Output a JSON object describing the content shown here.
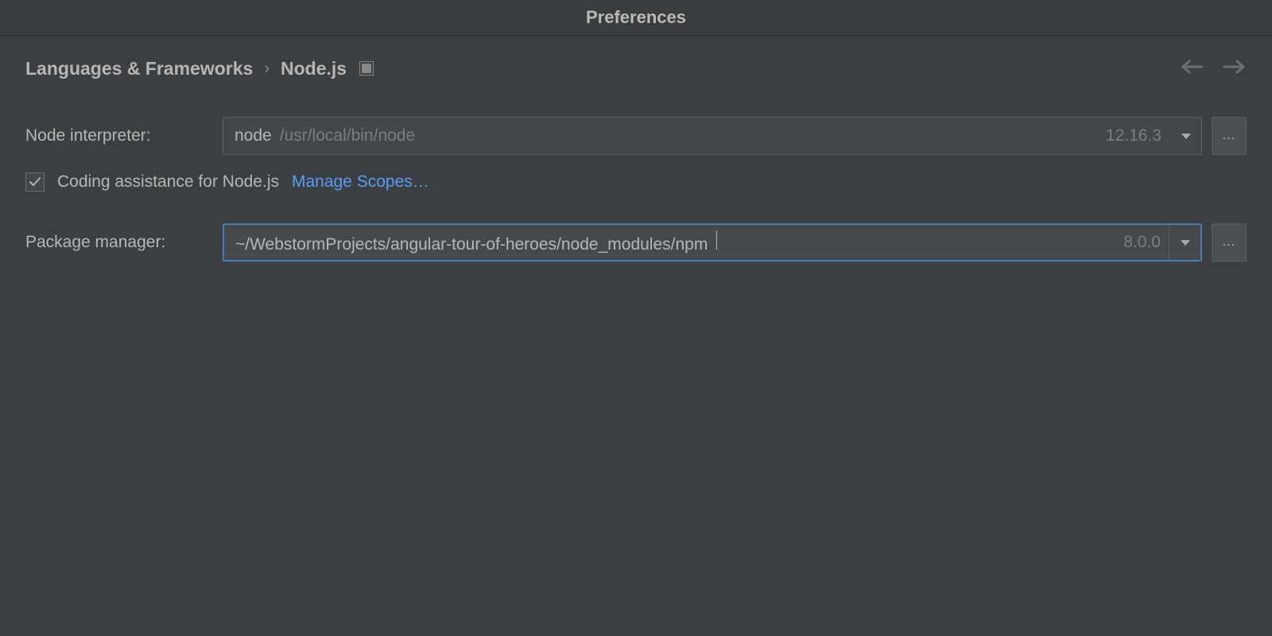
{
  "window": {
    "title": "Preferences"
  },
  "breadcrumb": {
    "root": "Languages & Frameworks",
    "separator": "›",
    "leaf": "Node.js"
  },
  "fields": {
    "interpreter_label": "Node interpreter:",
    "interpreter_prefix": "node",
    "interpreter_path": "/usr/local/bin/node",
    "interpreter_version": "12.16.3",
    "coding_assistance_label": "Coding assistance for Node.js",
    "coding_assistance_checked": true,
    "manage_scopes": "Manage Scopes…",
    "pkg_manager_label": "Package manager:",
    "pkg_manager_value": "~/WebstormProjects/angular-tour-of-heroes/node_modules/npm",
    "pkg_manager_version": "8.0.0"
  },
  "ellipsis": "..."
}
